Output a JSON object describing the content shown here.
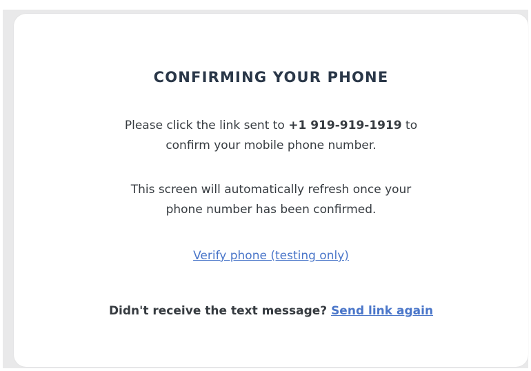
{
  "dialog": {
    "title": "CONFIRMING YOUR PHONE",
    "message_line1_prefix": "Please click the link sent to",
    "phone_number": "+1 919-919-1919",
    "message_line1_suffix": "to",
    "message_line2": "confirm your mobile phone number.",
    "refresh_line1": "This screen will automatically refresh once your",
    "refresh_line2": "phone number has been confirmed.",
    "verify_link": "Verify phone (testing only)",
    "resend_prompt": "Didn't receive the text message?",
    "resend_link": "Send link again"
  },
  "colors": {
    "title": "#2a3748",
    "text": "#363b40",
    "link": "#4a76c9",
    "backdrop": "#e9e9ea"
  }
}
